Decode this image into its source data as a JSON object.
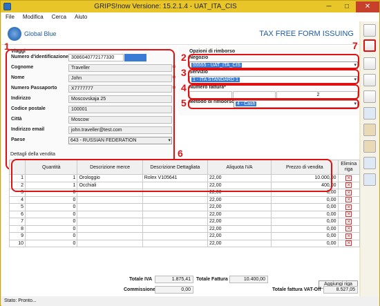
{
  "window": {
    "title": "GRIPS!now Versione: 15.2.1.4 - UAT_ITA_CIS",
    "min": "─",
    "max": "□",
    "close": "✕"
  },
  "menu": [
    "File",
    "Modifica",
    "Cerca",
    "Aiuto"
  ],
  "header": {
    "logo": "Global Blue",
    "title": "TAX FREE FORM ISSUING"
  },
  "traveller": {
    "section": "Viaggi",
    "id_label": "Numero d'identificazione",
    "id_value": "3086040772177330",
    "surname_label": "Cognome",
    "surname_value": "Traveller",
    "name_label": "Nome",
    "name_value": "John",
    "passport_label": "Numero Passaporto",
    "passport_value": "X7777777",
    "address_label": "Indirizzo",
    "address_value": "Moscovskaja 25",
    "zip_label": "Codice postale",
    "zip_value": "100001",
    "city_label": "Città",
    "city_value": "Moscow",
    "email_label": "Indirizzo email",
    "email_value": "john.traveller@test.com",
    "country_label": "Paese",
    "country_value": "643 - RUSSIAN FEDERATION"
  },
  "refund": {
    "section": "Opzioni di rimborso",
    "shop_label": "Negozio",
    "shop_value": "55555 - UAT_ITA_CIS",
    "service_label": "Servizio",
    "service_value": "1 - ITA STANDARD 1",
    "invoice_label": "Numero fattura*",
    "invoice_value": "2",
    "method_label": "Metodo di rimborso*",
    "method_value": "4 - Cash"
  },
  "callouts": [
    "1",
    "2",
    "3",
    "4",
    "5",
    "6",
    "7"
  ],
  "sales": {
    "section": "Dettagli della vendita",
    "columns": [
      "Quantità",
      "Descrizione merce",
      "Descrizione Dettagliata",
      "Aliquota IVA",
      "Prezzo di vendita",
      "Elimina riga"
    ],
    "rows": [
      {
        "n": "1",
        "qty": "1",
        "desc": "Orologgio",
        "detail": "Rolex V105641",
        "vat": "22,00",
        "price": "10.000,00"
      },
      {
        "n": "2",
        "qty": "1",
        "desc": "Occhiali",
        "detail": "",
        "vat": "22,00",
        "price": "400,00"
      },
      {
        "n": "3",
        "qty": "0",
        "desc": "",
        "detail": "",
        "vat": "22,00",
        "price": "0,00"
      },
      {
        "n": "4",
        "qty": "0",
        "desc": "",
        "detail": "",
        "vat": "22,00",
        "price": "0,00"
      },
      {
        "n": "5",
        "qty": "0",
        "desc": "",
        "detail": "",
        "vat": "22,00",
        "price": "0,00"
      },
      {
        "n": "6",
        "qty": "0",
        "desc": "",
        "detail": "",
        "vat": "22,00",
        "price": "0,00"
      },
      {
        "n": "7",
        "qty": "0",
        "desc": "",
        "detail": "",
        "vat": "22,00",
        "price": "0,00"
      },
      {
        "n": "8",
        "qty": "0",
        "desc": "",
        "detail": "",
        "vat": "22,00",
        "price": "0,00"
      },
      {
        "n": "9",
        "qty": "0",
        "desc": "",
        "detail": "",
        "vat": "22,00",
        "price": "0,00"
      },
      {
        "n": "10",
        "qty": "0",
        "desc": "",
        "detail": "",
        "vat": "22,00",
        "price": "0,00"
      }
    ],
    "add_row": "Aggiungi riga"
  },
  "totals": {
    "vat_label": "Totale IVA",
    "vat_value": "1.875,41",
    "invoice_label": "Totale Fattura",
    "invoice_value": "10.400,00",
    "fee_label": "Commissione",
    "fee_value": "0,00",
    "vatoff_label": "Totale fattura VAT-Off",
    "vatoff_value": "8.527,05"
  },
  "status": "Stato: Pronto...",
  "icons": [
    "search-icon",
    "delete-icon",
    "dropdown-arrow-icon",
    "toolbar-new-icon",
    "toolbar-edit-icon",
    "toolbar-print-icon",
    "toolbar-search-icon",
    "toolbar-refresh-icon"
  ],
  "colors": {
    "title_bar": "#e8c62a",
    "callout": "#e01010",
    "selection": "#3a7bd5",
    "brand": "#1f5aa0"
  }
}
